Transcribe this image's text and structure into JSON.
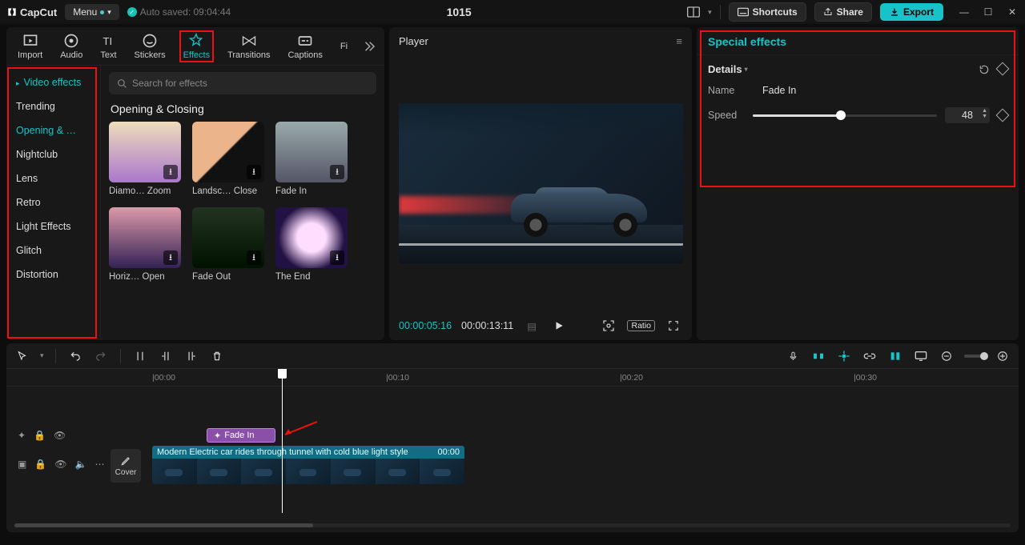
{
  "app": {
    "name": "CapCut",
    "menu_label": "Menu",
    "autosaved": "Auto saved: 09:04:44",
    "project_title": "1015"
  },
  "header_buttons": {
    "shortcuts": "Shortcuts",
    "share": "Share",
    "export": "Export"
  },
  "tabs": {
    "import": "Import",
    "audio": "Audio",
    "text": "Text",
    "stickers": "Stickers",
    "effects": "Effects",
    "transitions": "Transitions",
    "captions": "Captions",
    "filters": "Fi"
  },
  "sidebar": {
    "header": "Video effects",
    "items": [
      "Trending",
      "Opening & …",
      "Nightclub",
      "Lens",
      "Retro",
      "Light Effects",
      "Glitch",
      "Distortion"
    ]
  },
  "search_placeholder": "Search for effects",
  "section_title": "Opening & Closing",
  "effects_row1": [
    "Diamo… Zoom",
    "Landsc… Close",
    "Fade In"
  ],
  "effects_row2": [
    "Horiz… Open",
    "Fade Out",
    "The End"
  ],
  "player": {
    "title": "Player",
    "time_current": "00:00:05:16",
    "time_total": "00:00:13:11",
    "ratio": "Ratio"
  },
  "right": {
    "title": "Special effects",
    "details": "Details",
    "name_label": "Name",
    "name_value": "Fade In",
    "speed_label": "Speed",
    "speed_value": "48"
  },
  "ruler": {
    "t0": "|00:00",
    "t1": "|00:10",
    "t2": "|00:20",
    "t3": "|00:30"
  },
  "fx_clip_label": "Fade In",
  "video_clip": {
    "title": "Modern Electric car rides through tunnel with cold blue light style",
    "dur": "00:00"
  },
  "cover_label": "Cover"
}
